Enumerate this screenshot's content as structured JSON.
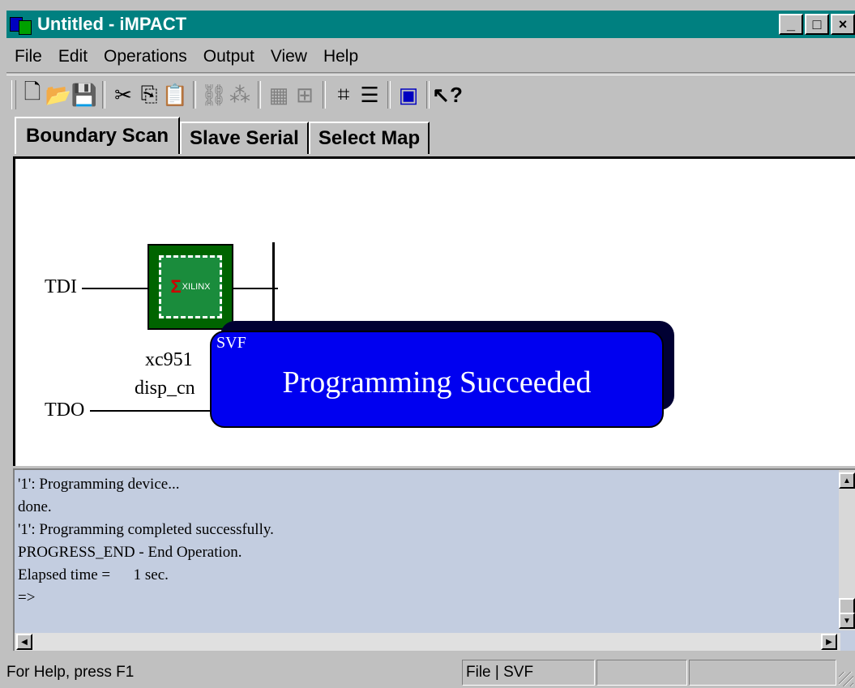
{
  "window": {
    "title": "Untitled - iMPACT",
    "controls": [
      "_",
      "□",
      "×"
    ]
  },
  "menu": [
    "File",
    "Edit",
    "Operations",
    "Output",
    "View",
    "Help"
  ],
  "toolbar": [
    "new-file-icon",
    "open-folder-icon",
    "save-icon",
    "cut-icon",
    "copy-icon",
    "paste-icon",
    "chain-icon-1",
    "chain-icon-2",
    "grid-icon-1",
    "grid-icon-2",
    "chip-icon",
    "list-icon",
    "program-icon",
    "context-help-icon"
  ],
  "tabs": [
    "Boundary Scan",
    "Slave Serial",
    "Select Map"
  ],
  "canvas": {
    "tdi_label": "TDI",
    "tdo_label": "TDO",
    "device_part": "xc951",
    "device_file": "disp_cn",
    "logo_text": "XILINX",
    "popup_tag": "SVF",
    "popup_message": "Programming Succeeded"
  },
  "log": [
    "'1': Programming device...",
    "done.",
    "'1': Programming completed successfully.",
    "PROGRESS_END - End Operation.",
    "Elapsed time =      1 sec.",
    "=>"
  ],
  "status": {
    "help": "For Help, press F1",
    "mode": "File | SVF",
    "pane2": "",
    "pane3": ""
  },
  "colors": {
    "titlebar": "#008080",
    "popup": "#0000f0",
    "log_bg": "#c3cde0",
    "chip": "#006400"
  }
}
